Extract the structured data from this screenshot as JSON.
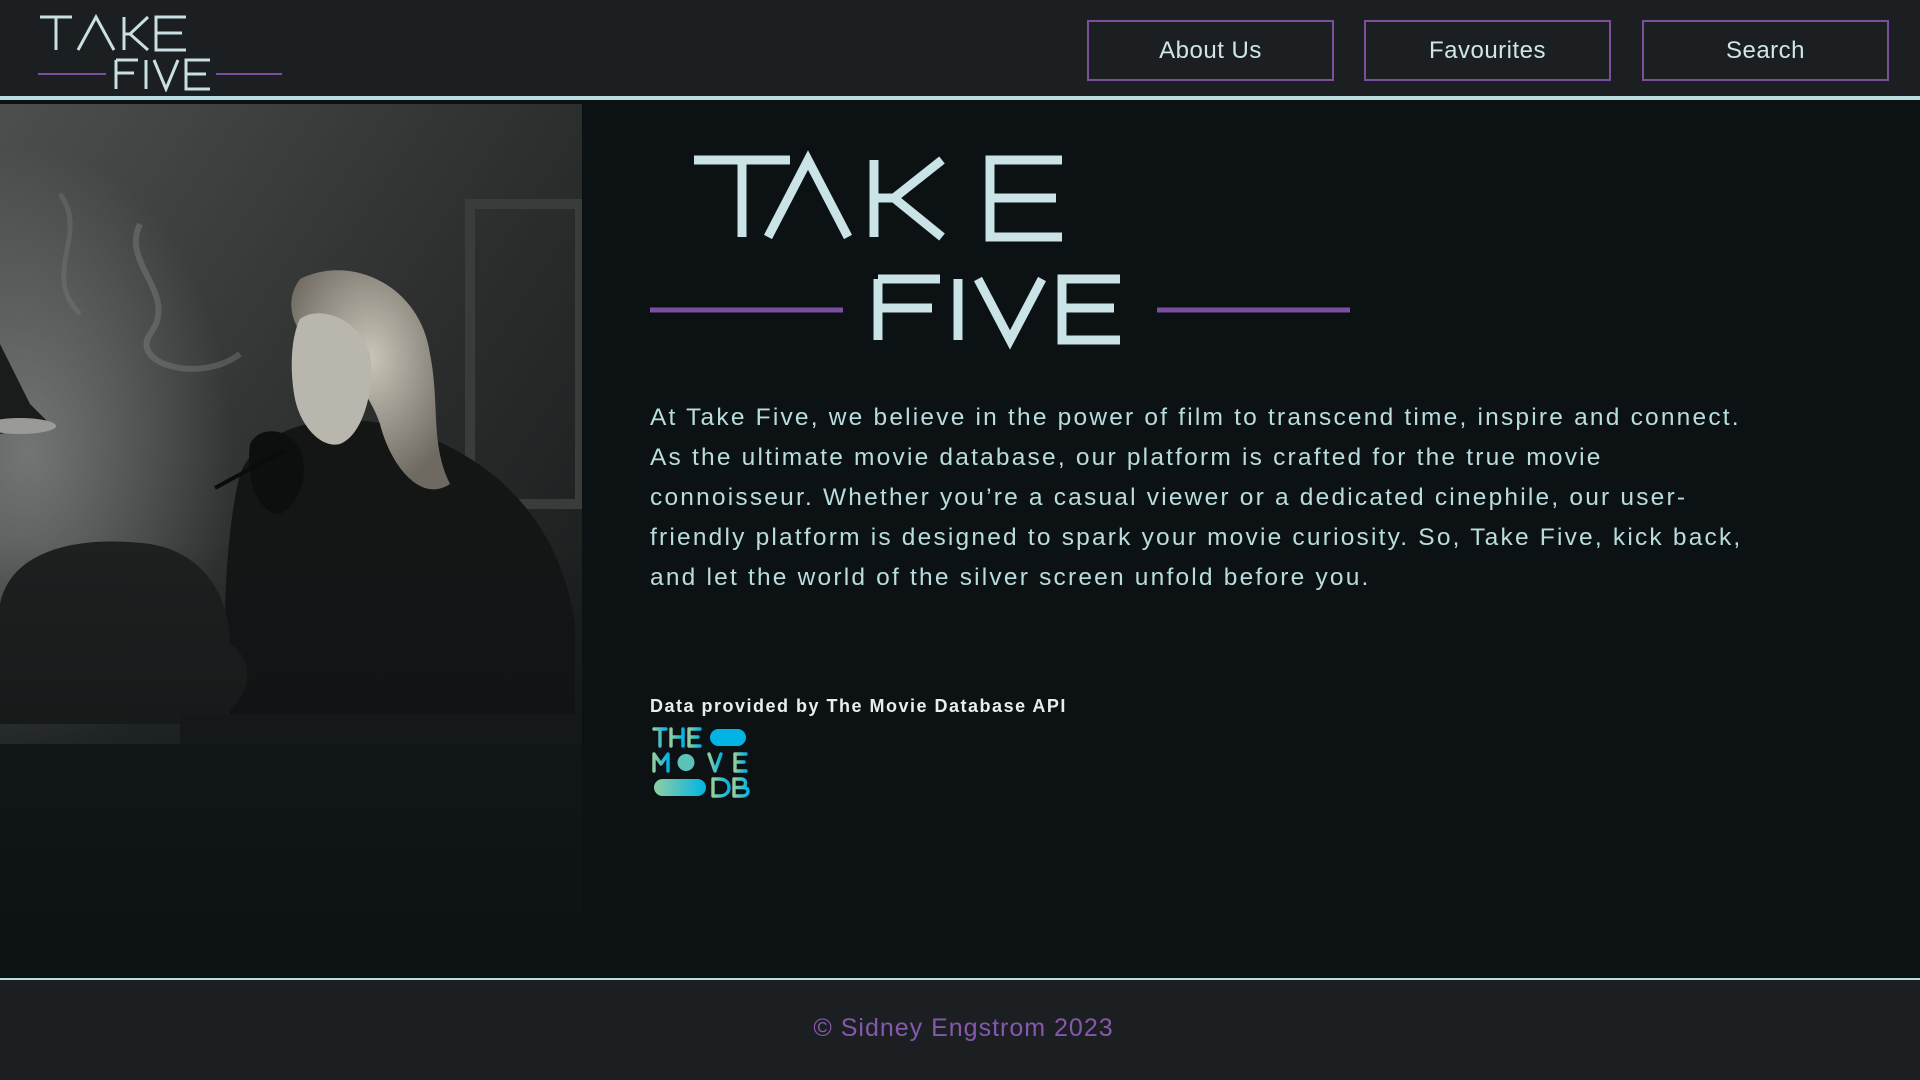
{
  "header": {
    "logo_alt": "TAKE FIVE",
    "nav": [
      {
        "label": "About Us"
      },
      {
        "label": "Favourites"
      },
      {
        "label": "Search"
      }
    ]
  },
  "main": {
    "logo_alt": "TAKE FIVE",
    "intro": "At Take Five, we believe in the power of film to transcend time, inspire and connect. As the ultimate movie database, our platform is crafted for the true movie connoisseur. Whether you’re a casual viewer or a dedicated cinephile, our user-friendly platform is designed to spark your movie curiosity. So, Take Five, kick back, and let the world of the silver screen unfold before you.",
    "attribution": "Data provided by The Movie Database API",
    "tmdb_logo_alt": "THE MOVIE DB"
  },
  "footer": {
    "copyright": "© Sidney Engstrom 2023"
  },
  "colors": {
    "header_bg": "#1b1f22",
    "page_bg": "#0c1213",
    "accent_purple": "#7a4f9e",
    "accent_cyan": "#b9dcde",
    "footer_text": "#8658ad"
  },
  "icons": [
    "take-five-logo",
    "tmdb-logo",
    "hero-photo"
  ]
}
